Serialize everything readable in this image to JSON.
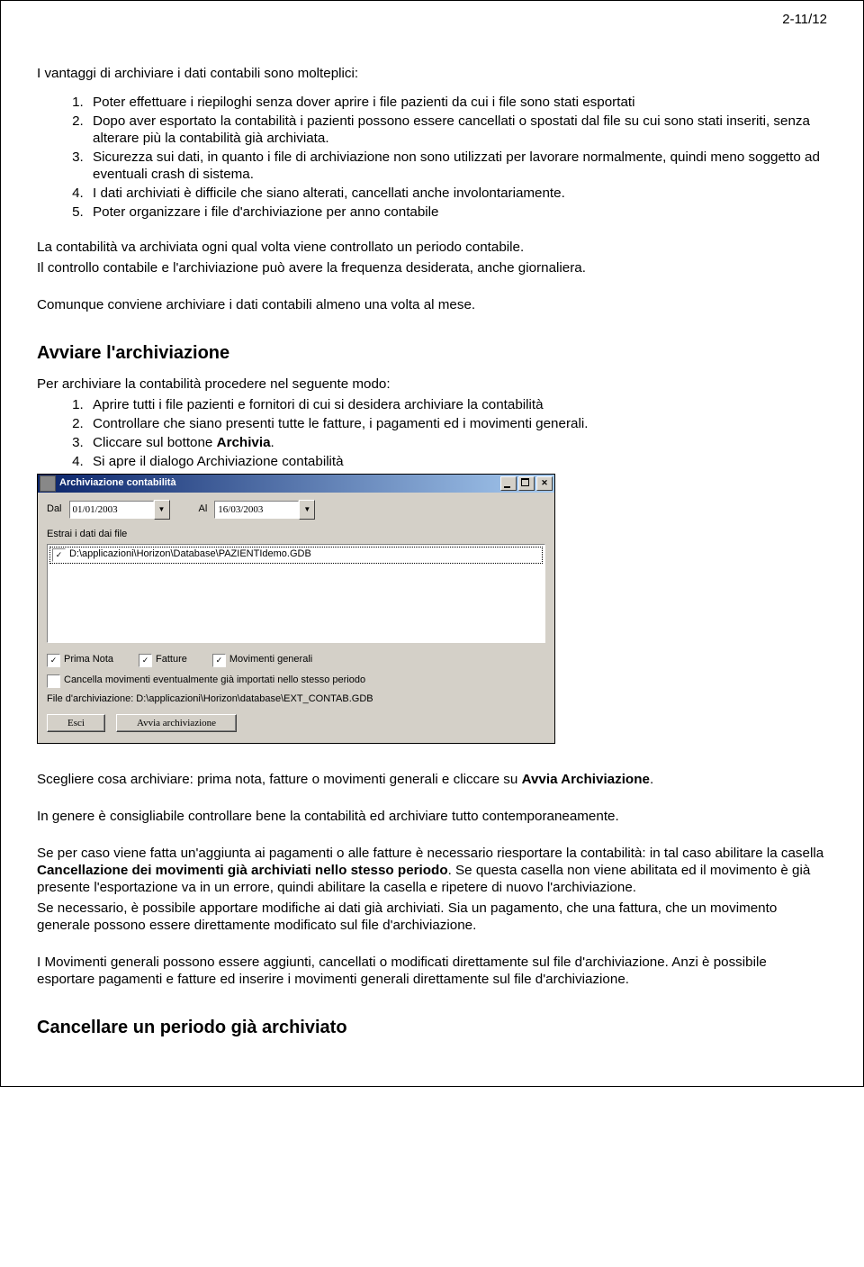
{
  "page_number": "2-11/12",
  "intro": {
    "lead": "I vantaggi di archiviare i dati contabili sono molteplici:",
    "items": [
      "Poter effettuare  i riepiloghi senza dover aprire i file pazienti da cui i file sono stati esportati",
      "Dopo aver esportato la contabilità i pazienti possono essere cancellati o spostati dal file su cui sono stati inseriti, senza alterare più la contabilità già archiviata.",
      "Sicurezza sui dati, in quanto i file di archiviazione non sono utilizzati per lavorare normalmente, quindi meno soggetto ad eventuali crash di sistema.",
      "I dati archiviati è difficile che siano alterati, cancellati anche involontariamente.",
      "Poter organizzare i file d'archiviazione per anno contabile"
    ],
    "p1": "La contabilità va archiviata ogni qual volta viene controllato un periodo contabile.",
    "p2": "Il controllo contabile e l'archiviazione può avere la frequenza desiderata, anche giornaliera.",
    "p3": "Comunque conviene archiviare i dati contabili almeno una volta al mese."
  },
  "section_start": {
    "heading": "Avviare l'archiviazione",
    "lead": "Per archiviare la contabilità procedere nel seguente modo:",
    "items": [
      "Aprire tutti i file pazienti e fornitori di cui si desidera archiviare la contabilità",
      "Controllare che siano presenti tutte le fatture, i pagamenti ed i movimenti generali.",
      {
        "pre": "Cliccare sul bottone ",
        "bold": "Archivia",
        "post": "."
      },
      "Si apre il dialogo Archiviazione contabilità"
    ]
  },
  "dialog": {
    "title": "Archiviazione contabilità",
    "from_label": "Dal",
    "from_value": "01/01/2003",
    "to_label": "Al",
    "to_value": "16/03/2003",
    "extract_label": "Estrai i dati dai file",
    "list_item": "D:\\applicazioni\\Horizon\\Database\\PAZIENTIdemo.GDB",
    "opt_prima": "Prima Nota",
    "opt_fatture": "Fatture",
    "opt_mov": "Movimenti generali",
    "opt_cancel": "Cancella movimenti eventualmente già importati nello stesso periodo",
    "file_label": "File d'archiviazione: D:\\applicazioni\\Horizon\\database\\EXT_CONTAB.GDB",
    "btn_esc": "Esci",
    "btn_go": "Avvia archiviazione"
  },
  "after": {
    "p1a": "Scegliere cosa archiviare: prima nota, fatture o movimenti generali e cliccare su ",
    "p1b": "Avvia Archiviazione",
    "p1c": ".",
    "p2": "In genere è consigliabile controllare bene la contabilità ed archiviare tutto contemporaneamente.",
    "p3a": "Se per caso viene fatta un'aggiunta ai pagamenti o alle fatture è necessario riesportare la contabilità: in tal caso abilitare la casella ",
    "p3b": "Cancellazione dei movimenti già archiviati nello stesso periodo",
    "p3c": ". Se questa casella non viene abilitata ed il movimento è già presente l'esportazione va in un errore, quindi abilitare la casella e ripetere di nuovo l'archiviazione.",
    "p4": "Se necessario, è possibile apportare modifiche ai dati già archiviati. Sia un pagamento, che una fattura, che un movimento generale possono essere direttamente modificato sul file d'archiviazione.",
    "p5": "I Movimenti generali possono essere aggiunti, cancellati o modificati direttamente sul file d'archiviazione. Anzi è possibile esportare pagamenti e fatture ed inserire i movimenti generali direttamente sul file d'archiviazione."
  },
  "section_cancel": {
    "heading": "Cancellare un periodo già archiviato"
  }
}
